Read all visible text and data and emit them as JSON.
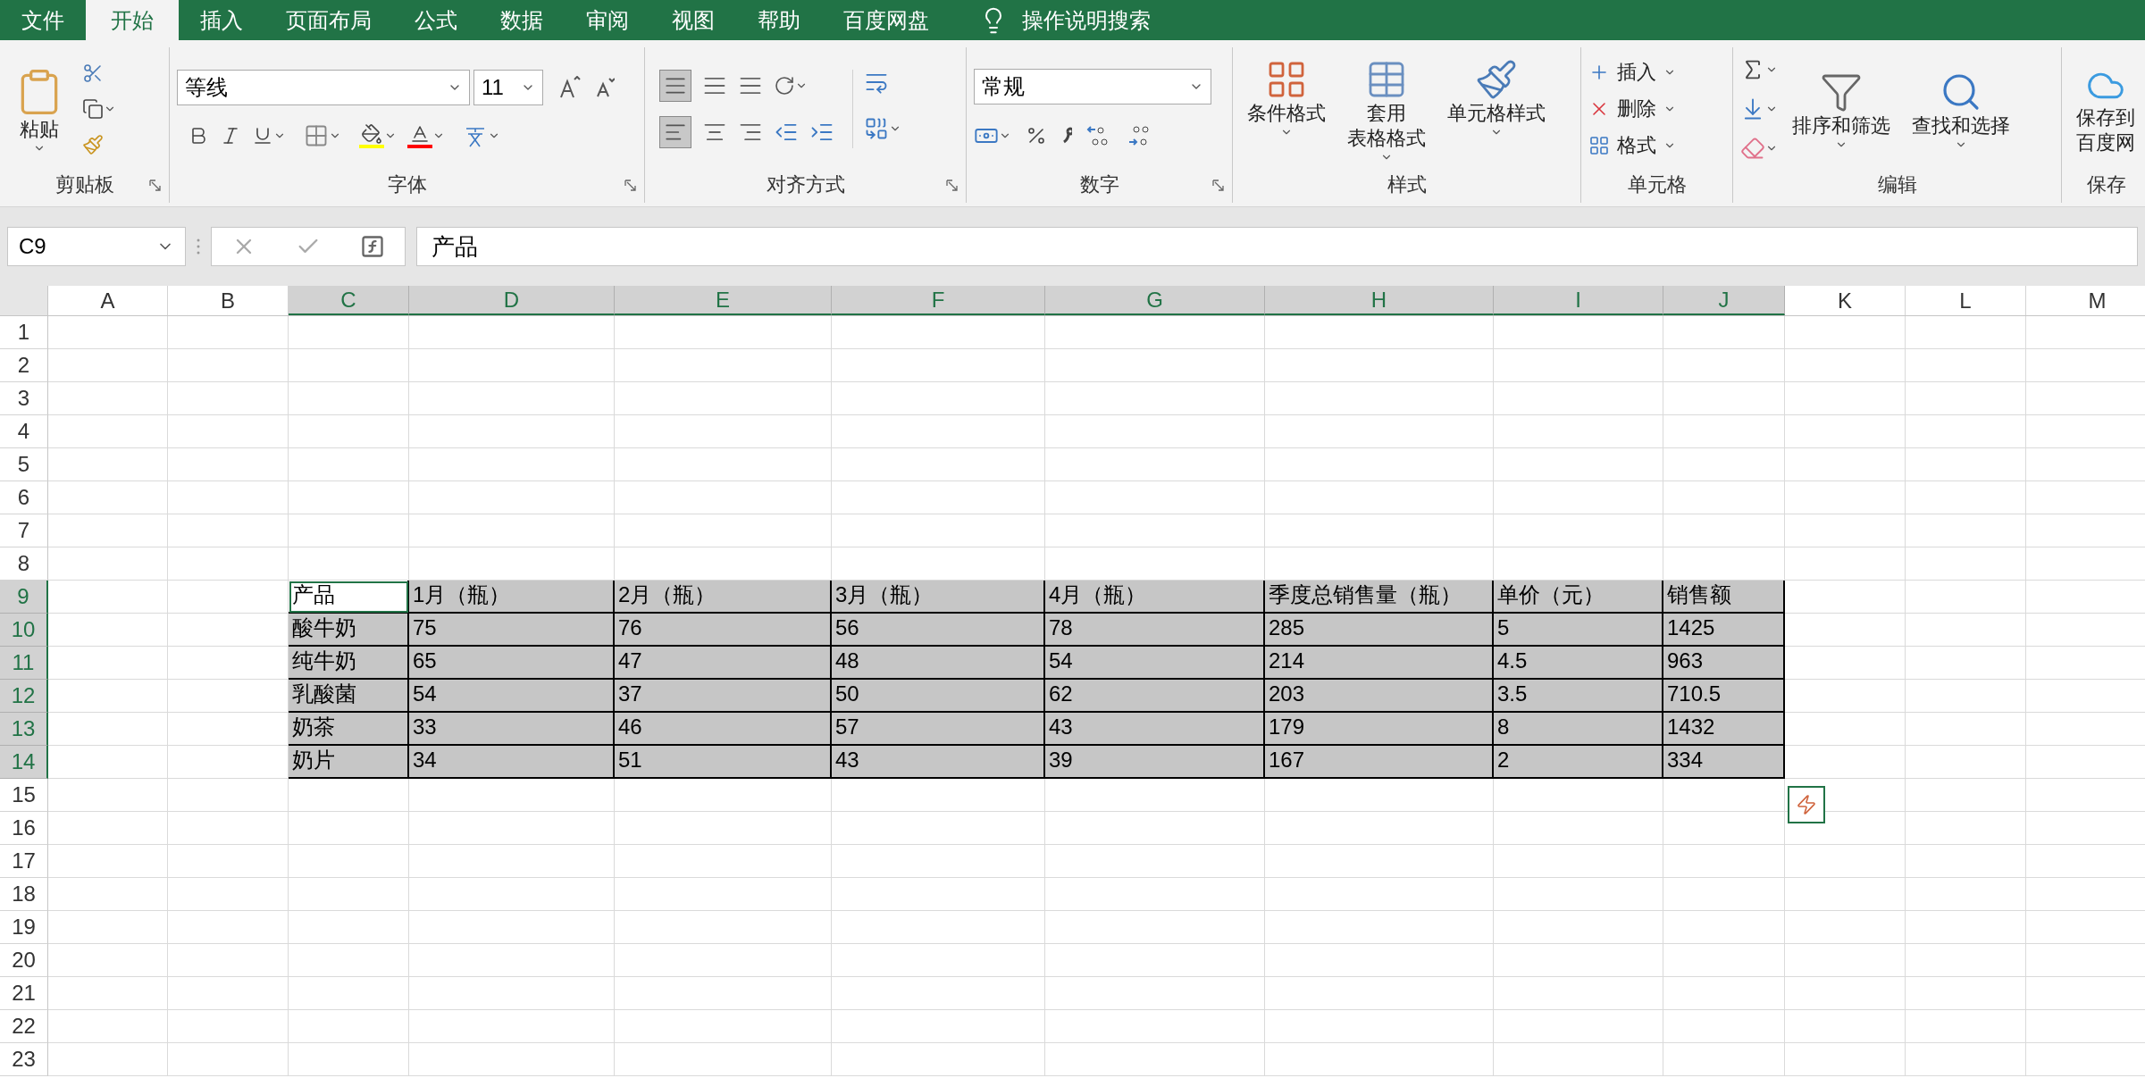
{
  "tabs": [
    {
      "label": "文件",
      "selected": false
    },
    {
      "label": "开始",
      "selected": true
    },
    {
      "label": "插入",
      "selected": false
    },
    {
      "label": "页面布局",
      "selected": false
    },
    {
      "label": "公式",
      "selected": false
    },
    {
      "label": "数据",
      "selected": false
    },
    {
      "label": "审阅",
      "selected": false
    },
    {
      "label": "视图",
      "selected": false
    },
    {
      "label": "帮助",
      "selected": false
    },
    {
      "label": "百度网盘",
      "selected": false
    }
  ],
  "tell_me": "操作说明搜索",
  "ribbon": {
    "clipboard": {
      "paste": "粘贴",
      "label": "剪贴板"
    },
    "font": {
      "font_name": "等线",
      "font_size": "11",
      "label": "字体"
    },
    "alignment": {
      "label": "对齐方式"
    },
    "number": {
      "format": "常规",
      "label": "数字"
    },
    "styles": {
      "conditional": "条件格式",
      "table_format": [
        "套用",
        "表格格式"
      ],
      "cell_styles": "单元格样式",
      "label": "样式"
    },
    "cells": {
      "buttons": [
        "插入",
        "删除",
        "格式"
      ],
      "label": "单元格"
    },
    "editing": {
      "sort_filter": "排序和筛选",
      "find_select": "查找和选择",
      "label": "编辑"
    },
    "save": {
      "button": [
        "保存到",
        "百度网"
      ],
      "label": "保存"
    }
  },
  "formula_bar": {
    "name_box": "C9",
    "value": "产品"
  },
  "sheet": {
    "columns": [
      {
        "label": "A",
        "selected": false
      },
      {
        "label": "B",
        "selected": false
      },
      {
        "label": "C",
        "selected": true
      },
      {
        "label": "D",
        "selected": true
      },
      {
        "label": "E",
        "selected": true
      },
      {
        "label": "F",
        "selected": true
      },
      {
        "label": "G",
        "selected": true
      },
      {
        "label": "H",
        "selected": true
      },
      {
        "label": "I",
        "selected": true
      },
      {
        "label": "J",
        "selected": true
      },
      {
        "label": "K",
        "selected": false
      },
      {
        "label": "L",
        "selected": false
      },
      {
        "label": "M",
        "selected": false
      }
    ],
    "rows": [
      {
        "label": "1",
        "selected": false
      },
      {
        "label": "2",
        "selected": false
      },
      {
        "label": "3",
        "selected": false
      },
      {
        "label": "4",
        "selected": false
      },
      {
        "label": "5",
        "selected": false
      },
      {
        "label": "6",
        "selected": false
      },
      {
        "label": "7",
        "selected": false
      },
      {
        "label": "8",
        "selected": false
      },
      {
        "label": "9",
        "selected": true,
        "cells": [
          {
            "text": "产品",
            "active": true
          },
          {
            "text": "1月（瓶）",
            "active": false
          },
          {
            "text": "2月（瓶）",
            "active": false
          },
          {
            "text": "3月（瓶）",
            "active": false
          },
          {
            "text": "4月（瓶）",
            "active": false
          },
          {
            "text": "季度总销售量（瓶）",
            "active": false
          },
          {
            "text": "单价（元）",
            "active": false
          },
          {
            "text": "销售额",
            "active": false
          }
        ]
      },
      {
        "label": "10",
        "selected": true,
        "cells": [
          {
            "text": "酸牛奶",
            "active": false
          },
          {
            "text": "75",
            "active": false
          },
          {
            "text": "76",
            "active": false
          },
          {
            "text": "56",
            "active": false
          },
          {
            "text": "78",
            "active": false
          },
          {
            "text": "285",
            "active": false
          },
          {
            "text": "5",
            "active": false
          },
          {
            "text": "1425",
            "active": false
          }
        ]
      },
      {
        "label": "11",
        "selected": true,
        "cells": [
          {
            "text": "纯牛奶",
            "active": false
          },
          {
            "text": "65",
            "active": false
          },
          {
            "text": "47",
            "active": false
          },
          {
            "text": "48",
            "active": false
          },
          {
            "text": "54",
            "active": false
          },
          {
            "text": "214",
            "active": false
          },
          {
            "text": "4.5",
            "active": false
          },
          {
            "text": "963",
            "active": false
          }
        ]
      },
      {
        "label": "12",
        "selected": true,
        "cells": [
          {
            "text": "乳酸菌",
            "active": false
          },
          {
            "text": "54",
            "active": false
          },
          {
            "text": "37",
            "active": false
          },
          {
            "text": "50",
            "active": false
          },
          {
            "text": "62",
            "active": false
          },
          {
            "text": "203",
            "active": false
          },
          {
            "text": "3.5",
            "active": false
          },
          {
            "text": "710.5",
            "active": false
          }
        ]
      },
      {
        "label": "13",
        "selected": true,
        "cells": [
          {
            "text": "奶茶",
            "active": false
          },
          {
            "text": "33",
            "active": false
          },
          {
            "text": "46",
            "active": false
          },
          {
            "text": "57",
            "active": false
          },
          {
            "text": "43",
            "active": false
          },
          {
            "text": "179",
            "active": false
          },
          {
            "text": "8",
            "active": false
          },
          {
            "text": "1432",
            "active": false
          }
        ]
      },
      {
        "label": "14",
        "selected": true,
        "cells": [
          {
            "text": "奶片",
            "active": false
          },
          {
            "text": "34",
            "active": false
          },
          {
            "text": "51",
            "active": false
          },
          {
            "text": "43",
            "active": false
          },
          {
            "text": "39",
            "active": false
          },
          {
            "text": "167",
            "active": false
          },
          {
            "text": "2",
            "active": false
          },
          {
            "text": "334",
            "active": false
          }
        ]
      },
      {
        "label": "15",
        "selected": false
      },
      {
        "label": "16",
        "selected": false
      },
      {
        "label": "17",
        "selected": false
      },
      {
        "label": "18",
        "selected": false
      },
      {
        "label": "19",
        "selected": false
      },
      {
        "label": "20",
        "selected": false
      },
      {
        "label": "21",
        "selected": false
      },
      {
        "label": "22",
        "selected": false
      },
      {
        "label": "23",
        "selected": false
      }
    ]
  }
}
